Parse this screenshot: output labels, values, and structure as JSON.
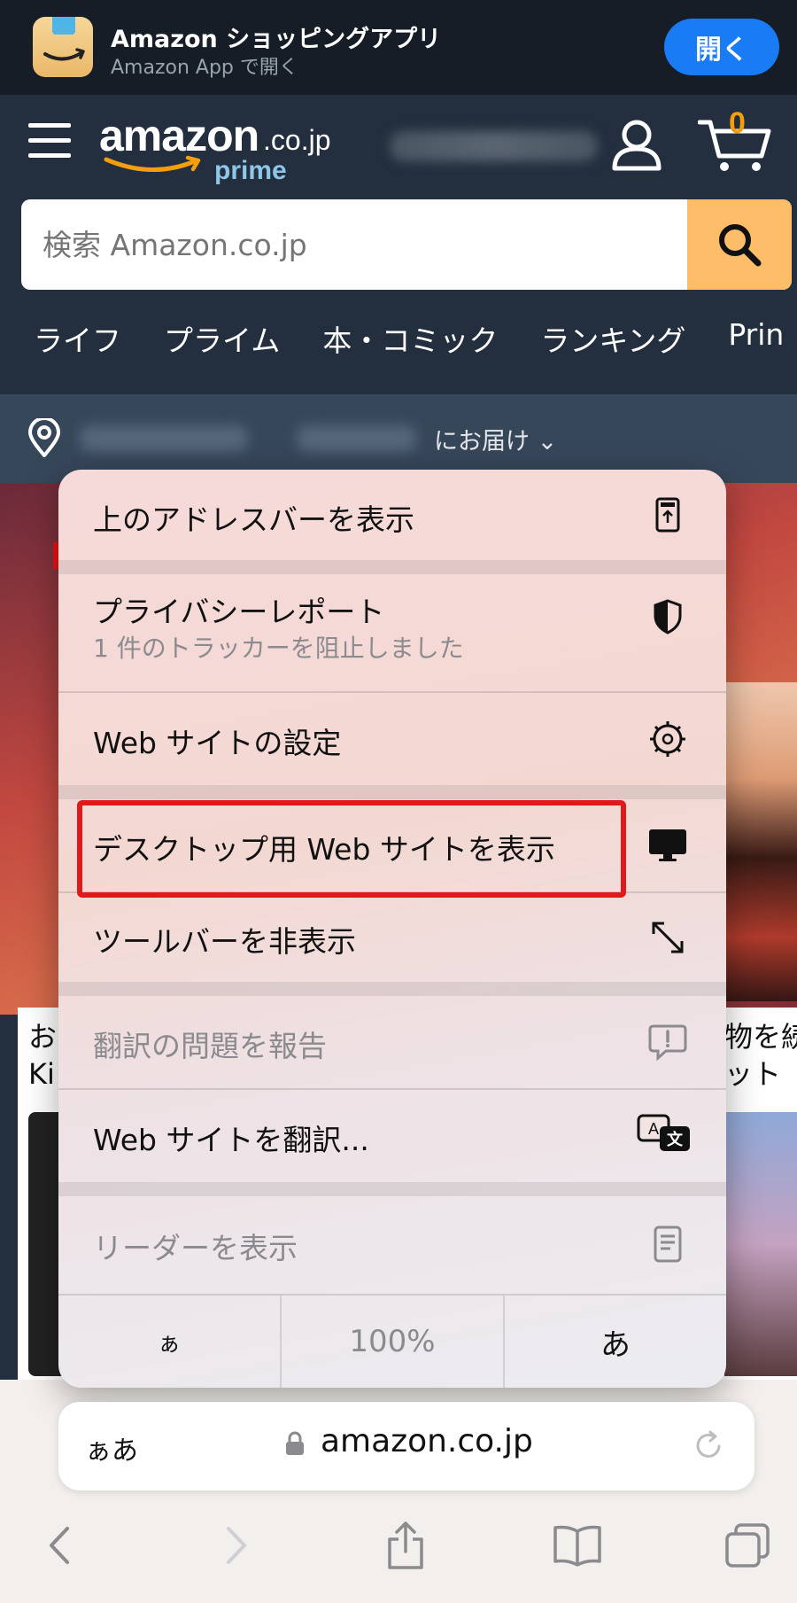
{
  "app_banner": {
    "title": "Amazon ショッピングアプリ",
    "subtitle": "Amazon App で開く",
    "open_button": "開く"
  },
  "header": {
    "logo_text": "amazon",
    "logo_domain": ".co.jp",
    "logo_prime": "prime",
    "cart_count": "0"
  },
  "search": {
    "placeholder": "検索 Amazon.co.jp"
  },
  "nav": {
    "items": [
      "ライフ",
      "プライム",
      "本・コミック",
      "ランキング",
      "Prin"
    ]
  },
  "location": {
    "deliver_text": "にお届け ⌄"
  },
  "background_cards": {
    "left_text": "お\nKi",
    "right_text": "物を続\nット"
  },
  "menu": {
    "items": [
      {
        "label": "上のアドレスバーを表示",
        "icon": "address-bar-top-icon"
      },
      {
        "label": "プライバシーレポート",
        "sub": "1 件のトラッカーを阻止しました",
        "icon": "shield-icon"
      },
      {
        "label": "Web サイトの設定",
        "icon": "gear-icon"
      },
      {
        "label": "デスクトップ用 Web サイトを表示",
        "icon": "desktop-icon"
      },
      {
        "label": "ツールバーを非表示",
        "icon": "resize-arrows-icon"
      },
      {
        "label": "翻訳の問題を報告",
        "icon": "report-bubble-icon"
      },
      {
        "label": "Web サイトを翻訳...",
        "icon": "translate-icon"
      },
      {
        "label": "リーダーを表示",
        "icon": "reader-icon"
      }
    ],
    "font_small": "ぁ",
    "zoom": "100%",
    "font_large": "あ",
    "highlight_color": "#e01a1a"
  },
  "address_bar": {
    "aa": "ぁあ",
    "url": "amazon.co.jp"
  },
  "colors": {
    "amazon_dark": "#232f3e",
    "search_button": "#febd69",
    "open_button": "#1a7cf5"
  }
}
